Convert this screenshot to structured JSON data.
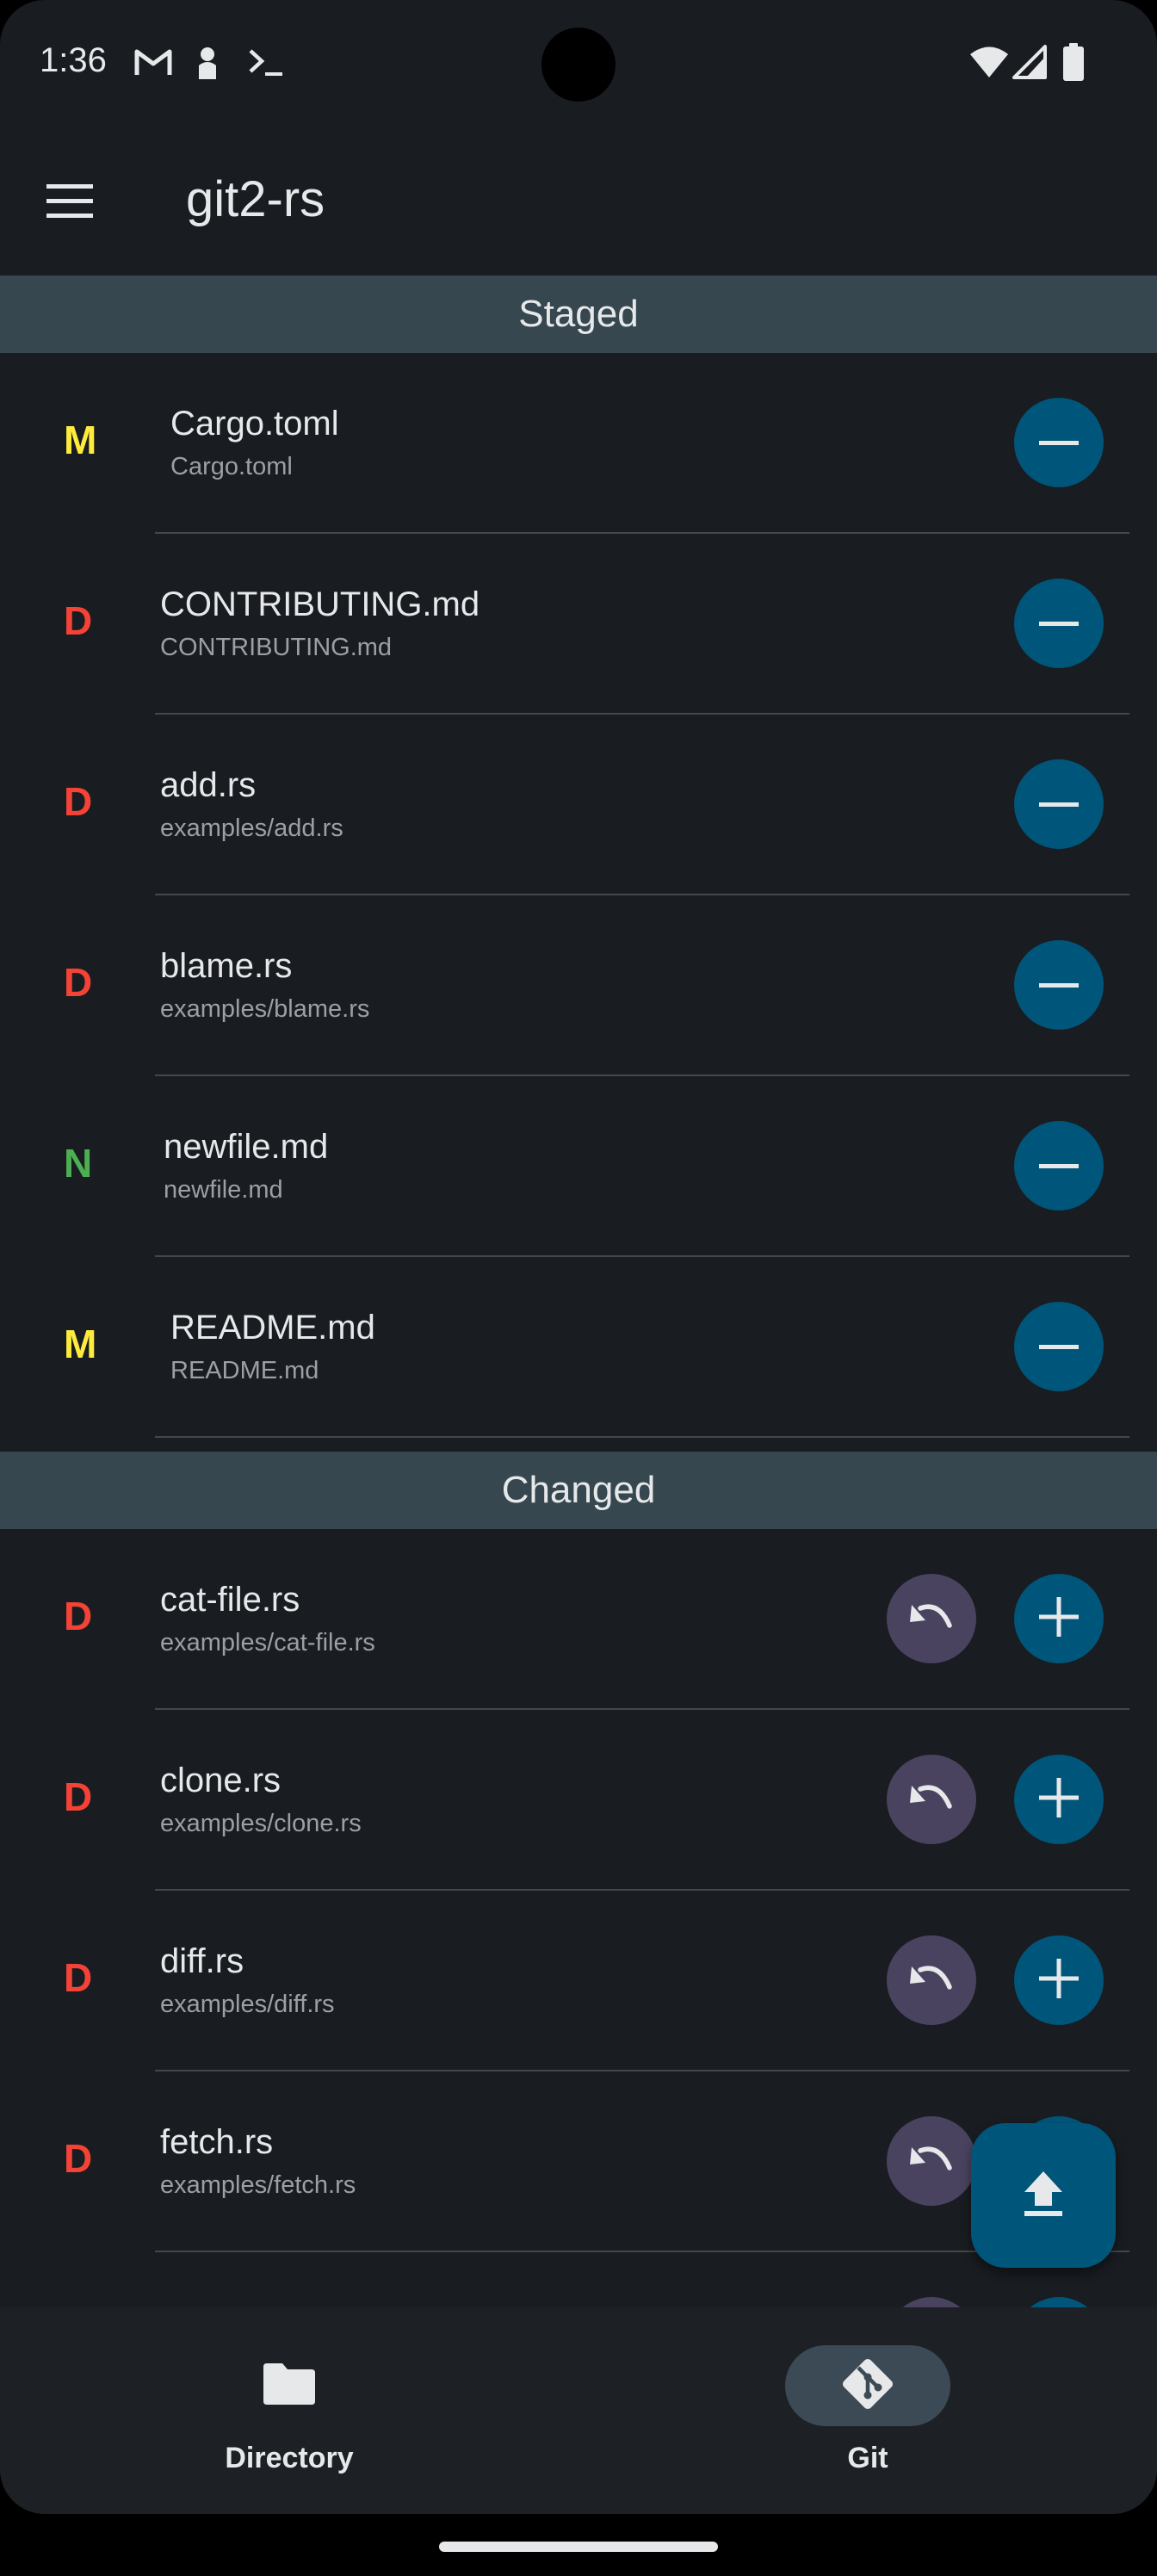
{
  "status_bar": {
    "time": "1:36",
    "left_icons": [
      "gmail-icon",
      "person-icon",
      "terminal-icon"
    ],
    "right_icons": [
      "wifi-icon",
      "signal-icon",
      "battery-icon"
    ]
  },
  "app_bar": {
    "title": "git2-rs",
    "menu_icon": "hamburger-menu-icon"
  },
  "colors": {
    "background": "#191c20",
    "section_header": "#37474f",
    "primary_button": "#00557a",
    "revert_button": "#4a4360",
    "modified": "#ffeb3b",
    "deleted": "#f44336",
    "new": "#4caf50"
  },
  "staged": {
    "header": "Staged",
    "items": [
      {
        "status": "M",
        "name": "Cargo.toml",
        "path": "Cargo.toml"
      },
      {
        "status": "D",
        "name": "CONTRIBUTING.md",
        "path": "CONTRIBUTING.md"
      },
      {
        "status": "D",
        "name": "add.rs",
        "path": "examples/add.rs"
      },
      {
        "status": "D",
        "name": "blame.rs",
        "path": "examples/blame.rs"
      },
      {
        "status": "N",
        "name": "newfile.md",
        "path": "newfile.md"
      },
      {
        "status": "M",
        "name": "README.md",
        "path": "README.md"
      }
    ]
  },
  "changed": {
    "header": "Changed",
    "items": [
      {
        "status": "D",
        "name": "cat-file.rs",
        "path": "examples/cat-file.rs"
      },
      {
        "status": "D",
        "name": "clone.rs",
        "path": "examples/clone.rs"
      },
      {
        "status": "D",
        "name": "diff.rs",
        "path": "examples/diff.rs"
      },
      {
        "status": "D",
        "name": "fetch.rs",
        "path": "examples/fetch.rs"
      }
    ]
  },
  "fab": {
    "icon": "upload-icon"
  },
  "bottom_nav": {
    "items": [
      {
        "label": "Directory",
        "icon": "folder-icon",
        "active": false
      },
      {
        "label": "Git",
        "icon": "git-icon",
        "active": true
      }
    ]
  }
}
